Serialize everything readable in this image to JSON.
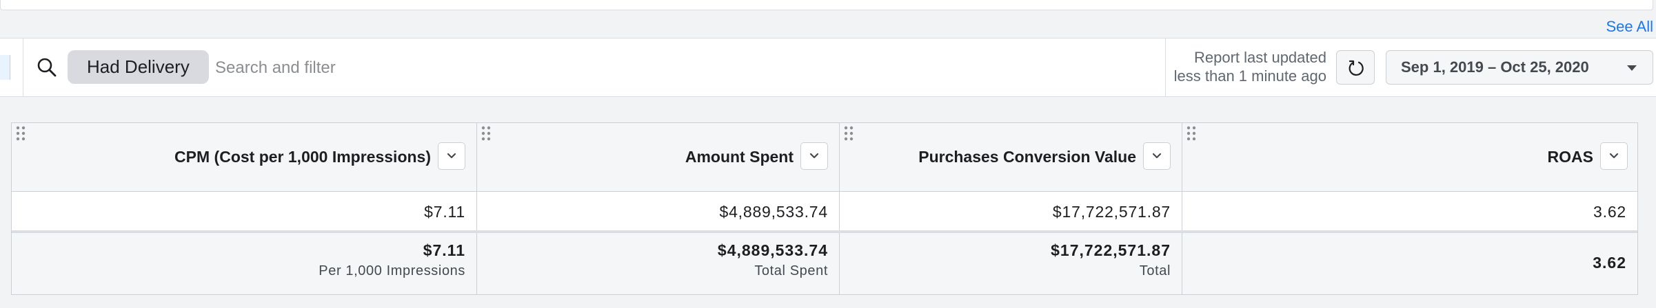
{
  "header": {
    "see_all_label": "See All"
  },
  "filter_bar": {
    "chip_label": "Had Delivery",
    "search_placeholder": "Search and filter",
    "report_status_line1": "Report last updated",
    "report_status_line2": "less than 1 minute ago",
    "date_range": "Sep 1, 2019 – Oct 25, 2020"
  },
  "table": {
    "columns": [
      {
        "label": "CPM (Cost per 1,000 Impressions)"
      },
      {
        "label": "Amount Spent"
      },
      {
        "label": "Purchases Conversion Value"
      },
      {
        "label": "ROAS"
      }
    ],
    "rows": [
      [
        "$7.11",
        "$4,889,533.74",
        "$17,722,571.87",
        "3.62"
      ]
    ],
    "totals": [
      {
        "value": "$7.11",
        "label": "Per 1,000 Impressions"
      },
      {
        "value": "$4,889,533.74",
        "label": "Total Spent"
      },
      {
        "value": "$17,722,571.87",
        "label": "Total"
      },
      {
        "value": "3.62",
        "label": ""
      }
    ]
  },
  "icons": {
    "search": "search-icon",
    "refresh": "refresh-icon",
    "caret": "caret-down-icon",
    "chevron": "chevron-down-icon",
    "drag": "drag-handle-icon"
  },
  "colors": {
    "link": "#1877f2",
    "chip_bg": "#d8dadf",
    "header_bg": "#f5f6f7",
    "page_bg": "#f2f3f5"
  }
}
